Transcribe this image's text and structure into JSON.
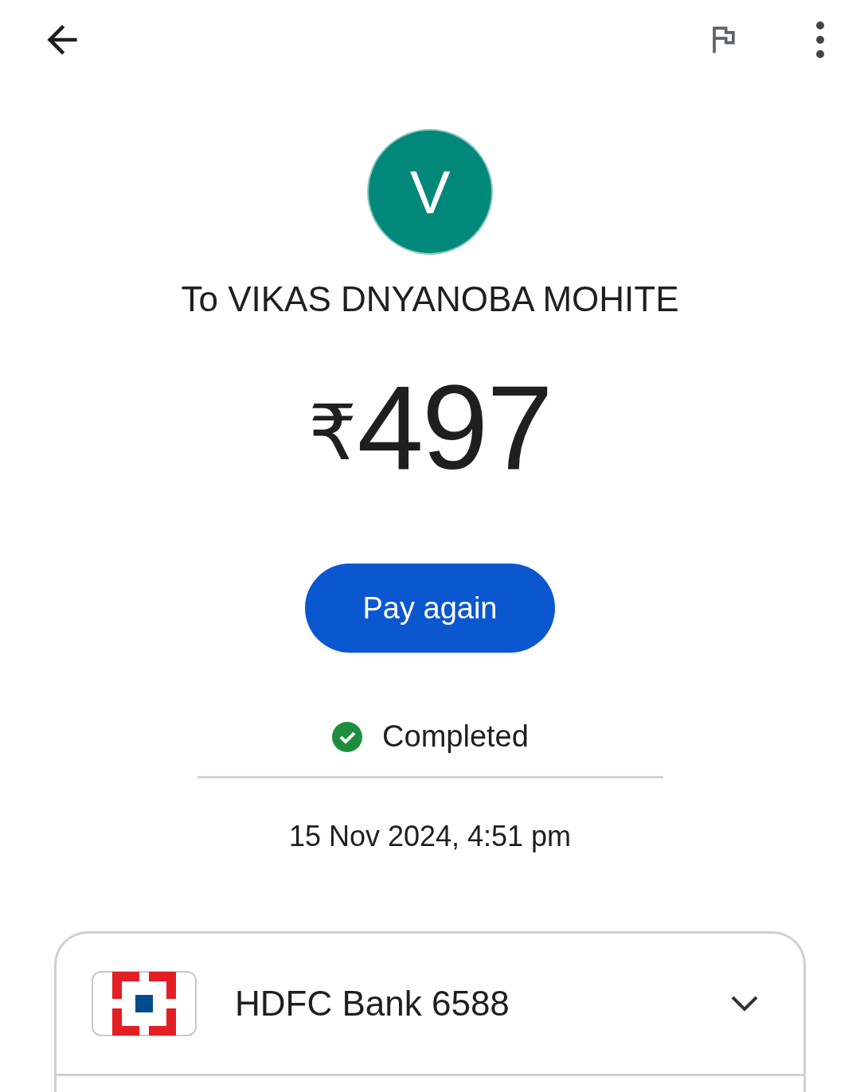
{
  "recipient": {
    "initial": "V",
    "name": "To VIKAS DNYANOBA MOHITE"
  },
  "amount": {
    "currency": "₹",
    "value": "497"
  },
  "action_button": {
    "label": "Pay again"
  },
  "status": {
    "kind": "completed",
    "label": "Completed"
  },
  "date": "15 Nov 2024, 4:51 pm",
  "account": {
    "name": "HDFC Bank 6588",
    "expanded": false
  }
}
